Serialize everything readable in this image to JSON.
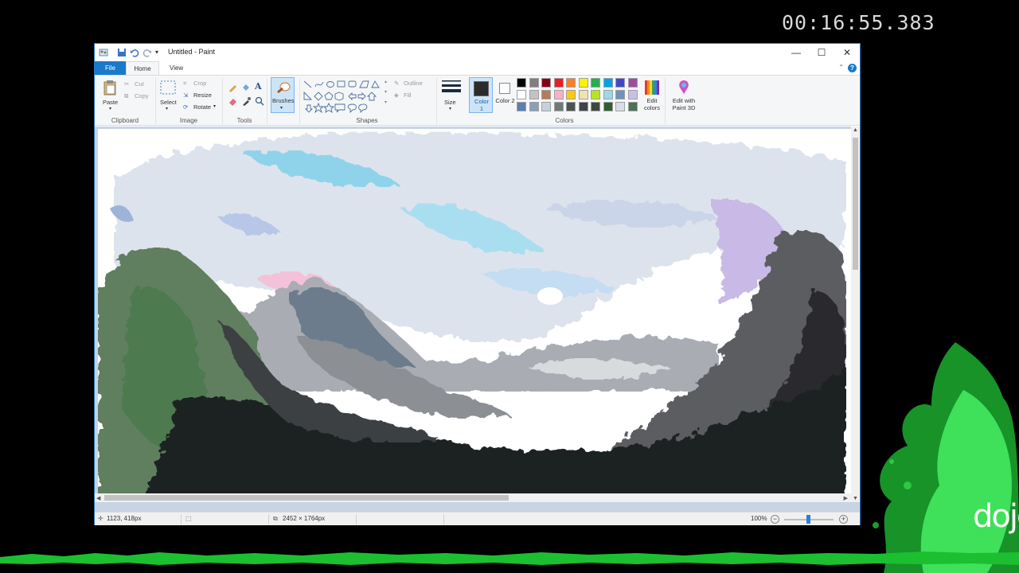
{
  "overlay": {
    "timer": "00:16:55.383"
  },
  "window": {
    "title": "Untitled - Paint",
    "controls": {
      "minimize": "—",
      "maximize": "☐",
      "close": "✕"
    }
  },
  "ribbon_tabs": [
    "File",
    "Home",
    "View"
  ],
  "ribbon": {
    "clipboard": {
      "label": "Clipboard",
      "paste": "Paste",
      "cut": "Cut",
      "copy": "Copy"
    },
    "image": {
      "label": "Image",
      "select": "Select",
      "crop": "Crop",
      "resize": "Resize",
      "rotate": "Rotate"
    },
    "tools": {
      "label": "Tools"
    },
    "brushes": {
      "label": "Brushes"
    },
    "shapes": {
      "label": "Shapes",
      "outline": "Outline",
      "fill": "Fill"
    },
    "size": {
      "label": "Size"
    },
    "color1": {
      "label": "Color 1",
      "value": "#2b2b2b"
    },
    "color2": {
      "label": "Color 2",
      "value": "#ffffff"
    },
    "colors": {
      "label": "Colors",
      "row1": [
        "#000000",
        "#7f7f7f",
        "#880015",
        "#ed1c24",
        "#ff7f27",
        "#fff200",
        "#22b14c",
        "#00a2e8",
        "#3f48cc",
        "#a349a4"
      ],
      "row2": [
        "#ffffff",
        "#c3c3c3",
        "#b97a57",
        "#ffaec9",
        "#ffc90e",
        "#efe4b0",
        "#b5e61d",
        "#99d9ea",
        "#7092be",
        "#c8bfe7"
      ],
      "row3": [
        "#5b7fb2",
        "#8aa0b8",
        "#c7d0dc",
        "#6f7a78",
        "#4c5352",
        "#404444",
        "#3e4a3f",
        "#2f5e33",
        "#d8dde4",
        "#4f7154"
      ]
    },
    "edit_colors": "Edit colors",
    "edit_paint3d": "Edit with Paint 3D"
  },
  "status": {
    "cursor_pos": "1123, 418px",
    "image_size": "2452 × 1764px",
    "zoom": "100%"
  }
}
